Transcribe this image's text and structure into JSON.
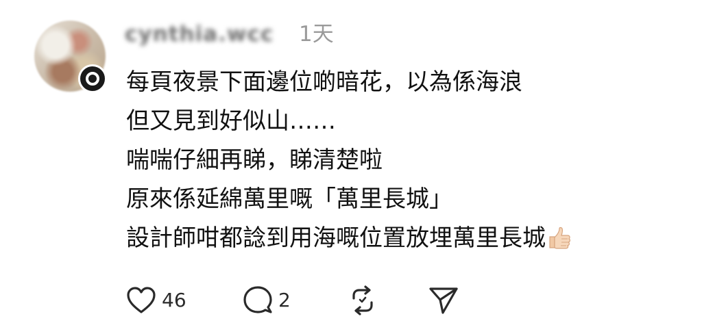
{
  "post": {
    "username": "cynthia.wcc",
    "timestamp": "1天",
    "body_lines": [
      "每頁夜景下面邊位啲暗花，以為係海浪",
      "但又見到好似山……",
      "喘喘仔細再睇，睇清楚啦",
      "原來係延綿萬里嘅「萬里長城」",
      "設計師咁都諗到用海嘅位置放埋萬里長城"
    ],
    "emoji": "thumbs-up-light-skin-tone"
  },
  "actions": {
    "like_count": "46",
    "comment_count": "2",
    "icons": [
      "heart-icon",
      "comment-icon",
      "repost-icon",
      "share-icon"
    ]
  },
  "colors": {
    "text": "#111111",
    "muted": "#9a9a9a",
    "icon": "#2a2a2a",
    "background": "#ffffff"
  }
}
